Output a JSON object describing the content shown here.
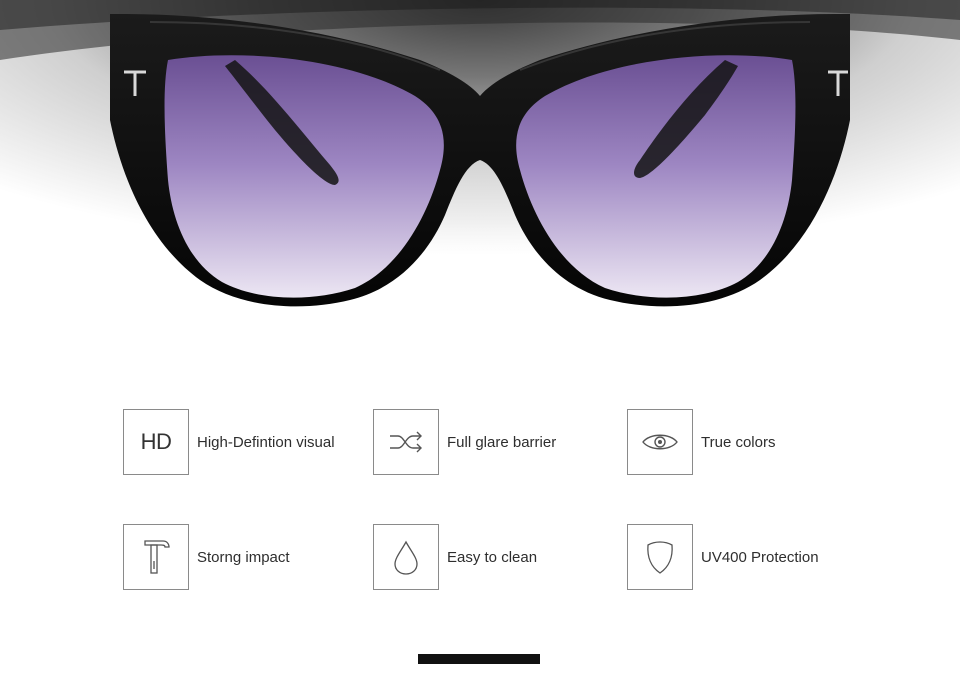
{
  "hero": {
    "product": "cat-eye-sunglasses-image",
    "frame_color": "#0c0c0c",
    "lens_color": "#8a6fb0"
  },
  "features": [
    {
      "icon": "hd-icon",
      "icon_text": "HD",
      "label": "High-Defintion visual"
    },
    {
      "icon": "shuffle-icon",
      "label": "Full glare barrier"
    },
    {
      "icon": "eye-icon",
      "label": "True colors"
    },
    {
      "icon": "hammer-icon",
      "label": "Storng impact"
    },
    {
      "icon": "water-drop-icon",
      "label": "Easy to clean"
    },
    {
      "icon": "shield-icon",
      "label": "UV400 Protection"
    }
  ],
  "colors": {
    "icon_border": "#8a8a8a",
    "text": "#2e2e2e",
    "bar": "#111111"
  }
}
